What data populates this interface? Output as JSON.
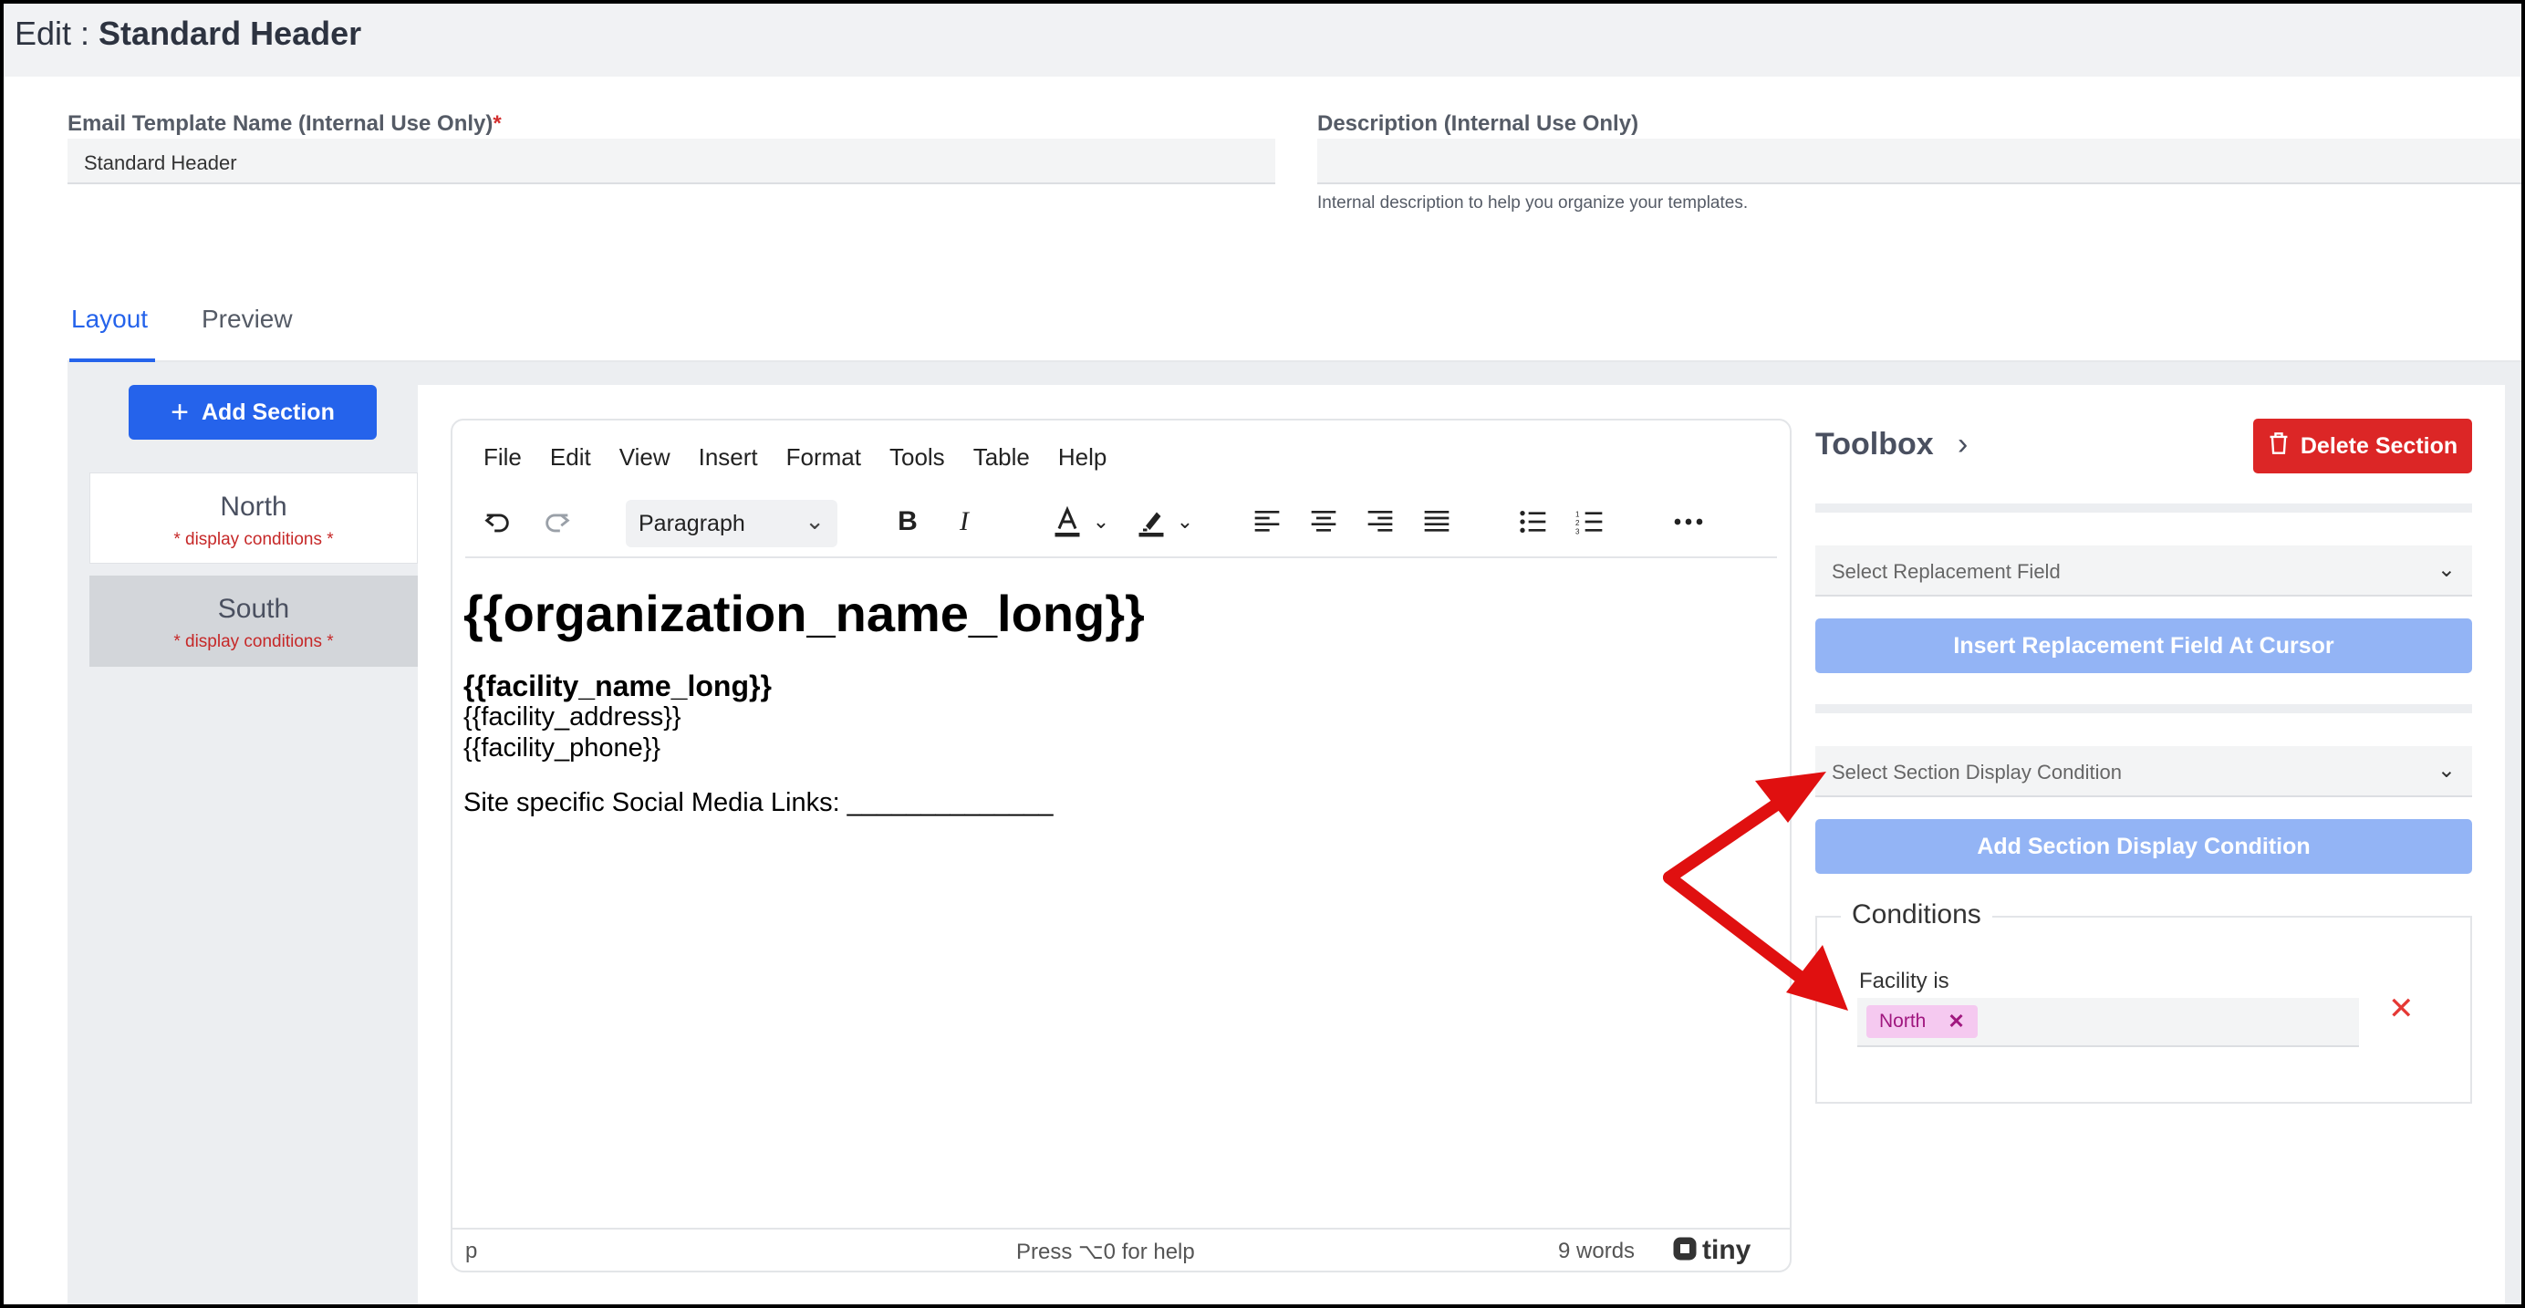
{
  "header": {
    "prefix": "Edit : ",
    "title": "Standard Header"
  },
  "form": {
    "name_label": "Email Template Name (Internal Use Only)",
    "required_mark": "*",
    "name_value": "Standard Header",
    "description_label": "Description (Internal Use Only)",
    "description_value": "",
    "description_hint": "Internal description to help you organize your templates."
  },
  "tabs": [
    {
      "label": "Layout",
      "active": true
    },
    {
      "label": "Preview",
      "active": false
    }
  ],
  "sections": {
    "add_label": "Add Section",
    "items": [
      {
        "name": "North",
        "note": "* display conditions *",
        "selected": true
      },
      {
        "name": "South",
        "note": "* display conditions *",
        "selected": false
      }
    ]
  },
  "editor": {
    "menu": [
      "File",
      "Edit",
      "View",
      "Insert",
      "Format",
      "Tools",
      "Table",
      "Help"
    ],
    "block_format": "Paragraph",
    "content": {
      "heading": "{{organization_name_long}}",
      "facility_name": "{{facility_name_long}}",
      "facility_address": "{{facility_address}}",
      "facility_phone": "{{facility_phone}}",
      "social": "Site specific Social Media Links: ______________"
    },
    "status": {
      "path": "p",
      "help": "Press ⌥0 for help",
      "words": "9 words",
      "brand": "tiny"
    }
  },
  "toolbox": {
    "title": "Toolbox",
    "delete_label": "Delete Section",
    "replacement_placeholder": "Select Replacement Field",
    "insert_label": "Insert Replacement Field At Cursor",
    "condition_placeholder": "Select Section Display Condition",
    "add_condition_label": "Add Section Display Condition",
    "conditions_title": "Conditions",
    "condition": {
      "label": "Facility is",
      "chips": [
        "North"
      ]
    }
  },
  "colors": {
    "primary": "#2563eb",
    "danger": "#dc2626",
    "disabled_button": "#93b4f5",
    "chip_bg": "#f5c9f0",
    "chip_text": "#a0177f",
    "annotation_arrow": "#e01010"
  }
}
